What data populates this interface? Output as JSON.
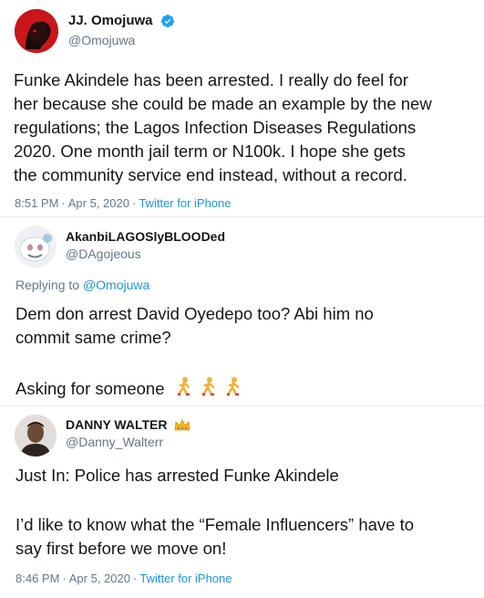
{
  "tweets": [
    {
      "author_name": "JJ. Omojuwa",
      "handle": "@Omojuwa",
      "verified": true,
      "avatar_icon": "red-silhouette-avatar",
      "lines": [
        "Funke Akindele has been arrested. I really do feel for",
        "her because she could be made an example by the new",
        "regulations; the Lagos Infection Diseases Regulations",
        "2020. One month jail term or N100k. I hope she gets",
        "the community service end instead, without a record."
      ],
      "time": "8:51 PM",
      "date": "Apr 5, 2020",
      "source": "Twitter for iPhone"
    },
    {
      "author_name": "AkanbiLAGOSlyBLOODed",
      "handle": "@DAgojeous",
      "avatar_icon": "sticker-avatar",
      "replying_label": "Replying to",
      "replying_to": "@Omojuwa",
      "lines": [
        "Dem don arrest David Oyedepo too? Abi him no",
        "commit same crime?"
      ],
      "line_last": "Asking for someone",
      "emoji_icon": "person-running-emoji"
    },
    {
      "author_name": "DANNY WALTER",
      "handle": "@Danny_Walterr",
      "name_badge_icon": "crown-emoji",
      "avatar_icon": "portrait-avatar",
      "line_first": "Just In: Police has arrested Funke Akindele",
      "lines": [
        "I’d like to know what the “Female Influencers” have to",
        "say first before we move on!"
      ],
      "time": "8:46 PM",
      "date": "Apr 5, 2020",
      "source": "Twitter for iPhone"
    }
  ],
  "separator": "·"
}
